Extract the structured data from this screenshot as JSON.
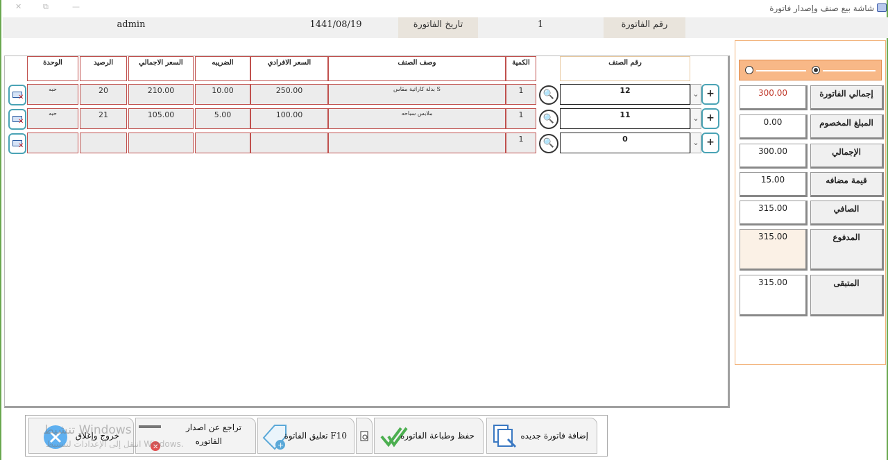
{
  "window": {
    "title": "شاشة بيع صنف وإصدار فاتورة",
    "controls": {
      "close": "✕",
      "restore": "⧉",
      "minimize": "—"
    }
  },
  "info": {
    "user": "admin",
    "invoice_date": "1441/08/19",
    "invoice_date_label": "تاريخ الفاتورة",
    "invoice_no": "1",
    "invoice_no_label": "رقم الفاتورة"
  },
  "grid": {
    "headers": {
      "item_no": "رقم الصنف",
      "qty": "الكمية",
      "description": "وصف الصنف",
      "unit_price": "السعر الافرادي",
      "tax": "الضريبه",
      "total_price": "السعر الاجمالي",
      "balance": "الرصيد",
      "unit": "الوحدة"
    },
    "rows": [
      {
        "item_no": "12",
        "qty": "1",
        "description": "بدلة كاراتية مقاس S",
        "unit_price": "250.00",
        "tax": "10.00",
        "total_price": "210.00",
        "balance": "20",
        "unit": "حبه"
      },
      {
        "item_no": "11",
        "qty": "1",
        "description": "ملابس سباحه",
        "unit_price": "100.00",
        "tax": "5.00",
        "total_price": "105.00",
        "balance": "21",
        "unit": "حبه"
      },
      {
        "item_no": "0",
        "qty": "1",
        "description": "",
        "unit_price": "",
        "tax": "",
        "total_price": "",
        "balance": "",
        "unit": ""
      }
    ],
    "plus_label": "+",
    "dropdown_glyph": "⌄",
    "search_glyph": "🔍"
  },
  "summary": {
    "items": [
      {
        "label": "إجمالي الفاتورة",
        "value": "300.00",
        "color": "#c0392b"
      },
      {
        "label": "المبلغ المخصوم",
        "value": "0.00",
        "color": "#222222"
      },
      {
        "label": "الإجمالي",
        "value": "300.00",
        "color": "#222222"
      },
      {
        "label": "قيمة مضافه",
        "value": "15.00",
        "color": "#222222"
      },
      {
        "label": "الصافي",
        "value": "315.00",
        "color": "#222222"
      },
      {
        "label": "المدفوع",
        "value": "315.00",
        "color": "#222222"
      },
      {
        "label": "المتبقى",
        "value": "315.00",
        "color": "#222222"
      }
    ]
  },
  "toolbar": {
    "new_invoice": "إضافة فاتورة جديده",
    "save_print": "حفظ وطباعة الفاتوره",
    "suspend": "تعليق الفاتوة F10",
    "cancel_line1": "تراجع عن اصدار",
    "cancel_line2": "الفاتوره",
    "exit": "خروج وإغلاق"
  },
  "watermark": {
    "line1": "تنشيط Windows",
    "line2": "انتقل إلى الإعدادات لتنشيط Windows."
  },
  "colors": {
    "accent": "#4aa3b5",
    "border_red": "#c0504d",
    "panel_orange": "#f8b887"
  }
}
